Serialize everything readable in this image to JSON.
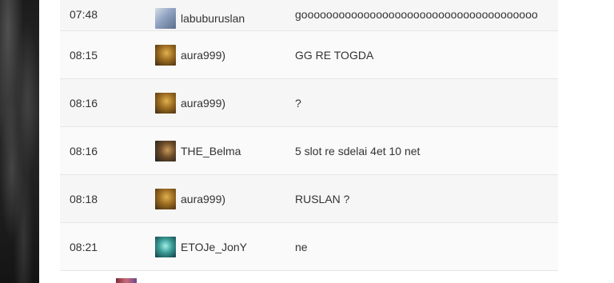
{
  "chat": {
    "rows": [
      {
        "time": "07:48",
        "player": "labuburuslan",
        "message": "goooooooooooooooooooooooooooooooooooooo",
        "avatar_icon": "hero-avatar-icon-labuburuslan",
        "avatar_colors": [
          "#8fa3c2",
          "#d7dde6"
        ]
      },
      {
        "time": "08:15",
        "player": "aura999)",
        "message": "GG RE TOGDA",
        "avatar_icon": "hero-avatar-icon-aura999",
        "avatar_colors": [
          "#5b3a12",
          "#c89a3a"
        ]
      },
      {
        "time": "08:16",
        "player": "aura999)",
        "message": "?",
        "avatar_icon": "hero-avatar-icon-aura999",
        "avatar_colors": [
          "#5b3a12",
          "#c89a3a"
        ]
      },
      {
        "time": "08:16",
        "player": "THE_Belma",
        "message": "5 slot re sdelai 4et 10 net",
        "avatar_icon": "hero-avatar-icon-the-belma",
        "avatar_colors": [
          "#2a2a2a",
          "#b78850"
        ]
      },
      {
        "time": "08:18",
        "player": "aura999)",
        "message": "RUSLAN ?",
        "avatar_icon": "hero-avatar-icon-aura999",
        "avatar_colors": [
          "#5b3a12",
          "#c89a3a"
        ]
      },
      {
        "time": "08:21",
        "player": "ETOJe_JonY",
        "message": "ne",
        "avatar_icon": "hero-avatar-icon-etoje-jony",
        "avatar_colors": [
          "#1f5a60",
          "#6fd2c8"
        ]
      }
    ]
  }
}
